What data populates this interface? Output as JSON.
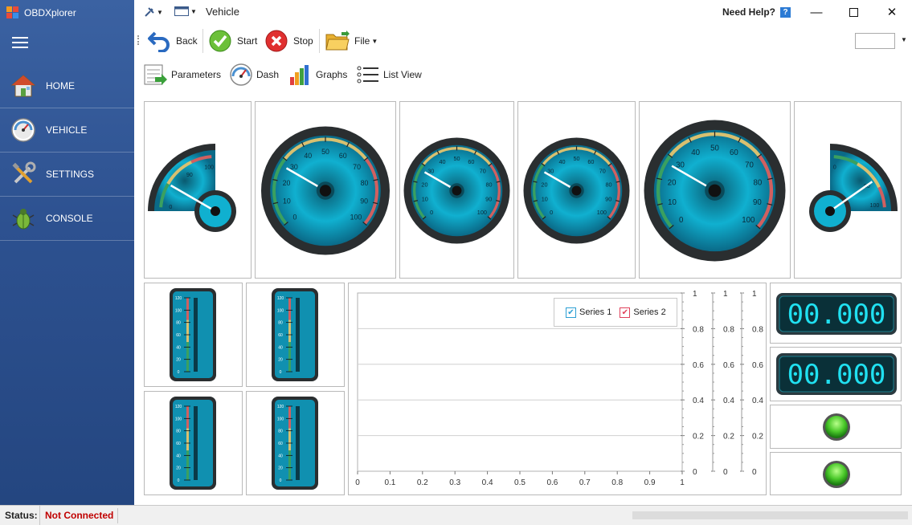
{
  "app": {
    "title": "OBDXplorer"
  },
  "sidebar": {
    "items": [
      {
        "label": "HOME",
        "icon": "home-icon"
      },
      {
        "label": "VEHICLE",
        "icon": "speedometer-icon"
      },
      {
        "label": "SETTINGS",
        "icon": "tools-icon"
      },
      {
        "label": "CONSOLE",
        "icon": "bug-icon"
      }
    ]
  },
  "titlebar": {
    "title": "Vehicle",
    "help_label": "Need Help?",
    "help_icon": "?"
  },
  "toolbar": {
    "back": "Back",
    "start": "Start",
    "stop": "Stop",
    "file": "File"
  },
  "viewbar": {
    "parameters": "Parameters",
    "dash": "Dash",
    "graphs": "Graphs",
    "list_view": "List View"
  },
  "gauges": {
    "large_ticks": [
      "0",
      "10",
      "20",
      "30",
      "40",
      "50",
      "60",
      "70",
      "80",
      "90",
      "100"
    ],
    "medium_ticks": [
      "0",
      "10",
      "20",
      "30",
      "40",
      "50",
      "60",
      "70",
      "80",
      "90",
      "100"
    ],
    "quarter_ticks": [
      "0",
      "90",
      "100"
    ],
    "quarter_ticks_right": [
      "0",
      "80",
      "100"
    ],
    "linear_ticks": [
      "0",
      "20",
      "40",
      "60",
      "80",
      "100",
      "120"
    ]
  },
  "digital": {
    "display_1": "00.000",
    "display_2": "00.000"
  },
  "chart_data": {
    "type": "line",
    "series": [
      {
        "name": "Series 1",
        "values": []
      },
      {
        "name": "Series 2",
        "values": []
      }
    ],
    "x_ticks": [
      "0",
      "0.1",
      "0.2",
      "0.3",
      "0.4",
      "0.5",
      "0.6",
      "0.7",
      "0.8",
      "0.9",
      "1"
    ],
    "y_ticks": [
      "0",
      "0.2",
      "0.4",
      "0.6",
      "0.8",
      "1"
    ],
    "xlim": [
      0,
      1
    ],
    "ylim": [
      0,
      1
    ],
    "grid": true,
    "legend": "top-right",
    "colors": {
      "series1": "#2c9fd4",
      "series2": "#e0405a"
    }
  },
  "status": {
    "label": "Status:",
    "value": "Not Connected"
  }
}
